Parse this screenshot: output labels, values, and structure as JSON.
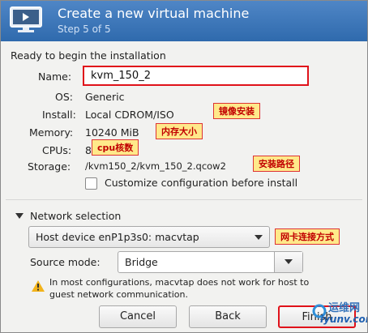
{
  "window": {
    "title": "Create a new virtual machine",
    "step": "Step 5 of 5"
  },
  "summary": {
    "heading": "Ready to begin the installation",
    "name_label": "Name:",
    "name_value": "kvm_150_2",
    "os_label": "OS:",
    "os_value": "Generic",
    "install_label": "Install:",
    "install_value": "Local CDROM/ISO",
    "memory_label": "Memory:",
    "memory_value": "10240 MiB",
    "cpus_label": "CPUs:",
    "cpus_value": "8",
    "storage_label": "Storage:",
    "storage_value": "/kvm150_2/kvm_150_2.qcow2",
    "customize_label": "Customize configuration before install",
    "customize_checked": false
  },
  "annotations": {
    "install": "镜像安装",
    "memory": "内存大小",
    "cpus": "cpu核数",
    "storage": "安装路径",
    "network": "网卡连接方式"
  },
  "network": {
    "section_label": "Network selection",
    "host_device": "Host device enP1p3s0: macvtap",
    "source_mode_label": "Source mode:",
    "source_mode_value": "Bridge",
    "warning_text": "In most configurations, macvtap does not work for host to guest network communication."
  },
  "buttons": {
    "cancel": "Cancel",
    "back": "Back",
    "finish": "Finish"
  },
  "watermark": {
    "text": "运维网",
    "sub": "iyunv.com"
  },
  "colors": {
    "header": "#3a74b8",
    "annotation_border": "#e0121a",
    "annotation_bg": "#ffe98a"
  }
}
